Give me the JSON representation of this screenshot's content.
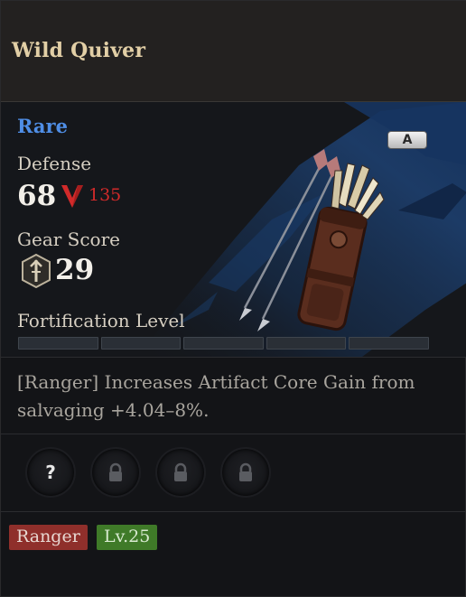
{
  "item": {
    "name": "Wild Quiver",
    "rarity": "Rare",
    "grade_badge": "A",
    "icon": "quiver-with-arrows-icon"
  },
  "stats": {
    "defense_label": "Defense",
    "defense_value": "68",
    "defense_compare": "135",
    "defense_compare_icon": "down-arrow-icon",
    "gear_score_label": "Gear Score",
    "gear_score_value": "29",
    "gear_score_icon": "gear-score-shield-icon",
    "fortification_label": "Fortification Level",
    "fortification_segments_total": 5,
    "fortification_segments_filled": 0
  },
  "description": "[Ranger] Increases Artifact Core Gain from salvaging +4.04–8%.",
  "sockets": [
    {
      "type": "unknown",
      "icon": "question-mark-icon"
    },
    {
      "type": "locked",
      "icon": "lock-icon"
    },
    {
      "type": "locked",
      "icon": "lock-icon"
    },
    {
      "type": "locked",
      "icon": "lock-icon"
    }
  ],
  "tags": {
    "class_label": "Ranger",
    "level_label": "Lv.25"
  },
  "colors": {
    "rarity": "#4f8ee6",
    "item_name": "#e2cfa6",
    "defense_down": "#d12a2a",
    "class_tag": "#8f2f2b",
    "level_tag": "#3f7a28",
    "splash_blue": "#1a3a66"
  }
}
